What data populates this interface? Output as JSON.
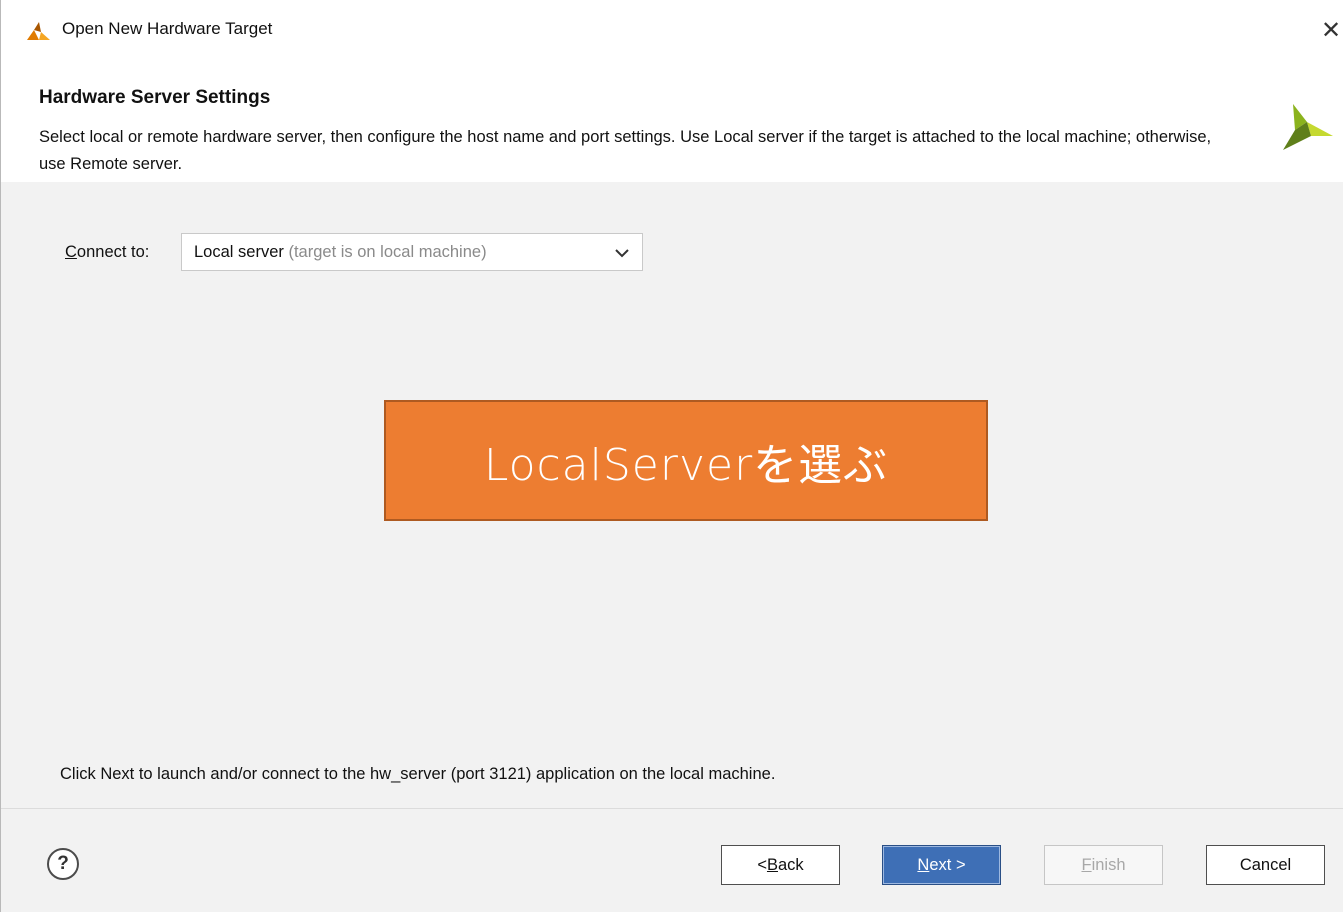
{
  "window": {
    "title": "Open New Hardware Target",
    "close_glyph": "✕"
  },
  "header": {
    "title": "Hardware Server Settings",
    "description": "Select local or remote hardware server, then configure the host name and port settings. Use Local server if the target is attached to the local machine; otherwise, use Remote server."
  },
  "connect": {
    "label_mnemonic": "C",
    "label_rest": "onnect to:",
    "selected_value": "Local server",
    "selected_hint": "(target is on local machine)"
  },
  "annotation": {
    "text": "LocalServerを選ぶ",
    "color": "#ed7d31"
  },
  "info_text": "Click Next to launch and/or connect to the hw_server (port 3121) application on the local machine.",
  "footer": {
    "help_glyph": "?",
    "back_prefix": "< ",
    "back_mnemonic": "B",
    "back_rest": "ack",
    "next_mnemonic": "N",
    "next_rest": "ext >",
    "finish_mnemonic": "F",
    "finish_rest": "inish",
    "cancel_label": "Cancel"
  },
  "colors": {
    "accent_blue": "#3e6fb6",
    "logo_dark": "#5f7f1a",
    "logo_light": "#c5d930"
  },
  "icons": {
    "app_logo": "xilinx-logo-icon",
    "close": "close-icon",
    "dropdown": "chevron-down-icon",
    "help": "help-icon"
  }
}
